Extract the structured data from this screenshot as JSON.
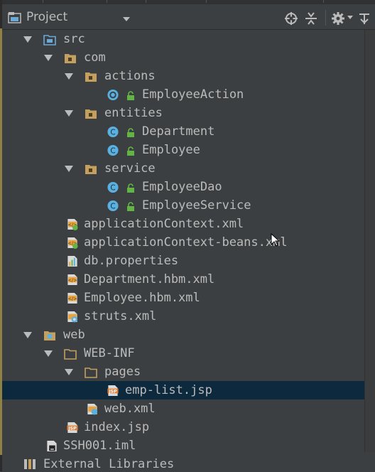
{
  "header": {
    "title": "Project",
    "tools": [
      "locate-icon",
      "collapse-icon",
      "settings-icon",
      "hide-icon"
    ]
  },
  "tree": {
    "src": "src",
    "com": "com",
    "actions": "actions",
    "EmployeeAction": "EmployeeAction",
    "entities": "entities",
    "Department": "Department",
    "Employee": "Employee",
    "service": "service",
    "EmployeeDao": "EmployeeDao",
    "EmployeeService": "EmployeeService",
    "appContext": "applicationContext.xml",
    "appContextBeans": "applicationContext-beans.xml",
    "dbProps": "db.properties",
    "deptHbm": "Department.hbm.xml",
    "empHbm": "Employee.hbm.xml",
    "struts": "struts.xml",
    "web": "web",
    "webinf": "WEB-INF",
    "pages": "pages",
    "empList": "emp-list.jsp",
    "webxml": "web.xml",
    "index": "index.jsp",
    "iml": "SSH001.iml",
    "extLibs": "External Libraries"
  },
  "colors": {
    "background": "#3c3f41",
    "selection": "#0d293e",
    "text": "#bbbbbb",
    "folder": "#c4a060",
    "source_folder": "#6aa9d8",
    "class": "#5ab0e0",
    "lock": "#62b543"
  }
}
